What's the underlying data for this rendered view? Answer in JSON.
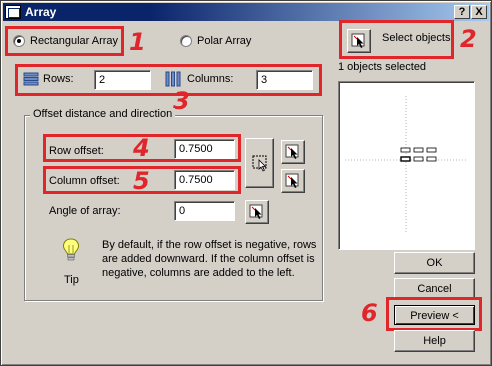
{
  "window": {
    "title": "Array",
    "help_btn": "?",
    "close_btn": "X"
  },
  "array_type": {
    "rectangular_label": "Rectangular Array",
    "polar_label": "Polar Array",
    "selected": "rectangular"
  },
  "select": {
    "button_label": "Select objects",
    "status": "1 objects selected"
  },
  "grid": {
    "rows_label": "Rows:",
    "rows_value": "2",
    "columns_label": "Columns:",
    "columns_value": "3"
  },
  "offset": {
    "group_title": "Offset distance and direction",
    "row_offset_label": "Row offset:",
    "row_offset_value": "0.7500",
    "column_offset_label": "Column offset:",
    "column_offset_value": "0.7500",
    "angle_label": "Angle of array:",
    "angle_value": "0"
  },
  "tip": {
    "label": "Tip",
    "text": "By default, if the row offset is negative, rows are added downward.  If the column offset is negative, columns are added to the left."
  },
  "buttons": {
    "ok": "OK",
    "cancel": "Cancel",
    "preview": "Preview <",
    "help": "Help"
  },
  "callouts": {
    "n1": "1",
    "n2": "2",
    "n3": "3",
    "n4": "4",
    "n5": "5",
    "n6": "6"
  },
  "colors": {
    "callout": "#e0252b",
    "title_bar": "#0a246a",
    "face": "#d4d0c8"
  }
}
